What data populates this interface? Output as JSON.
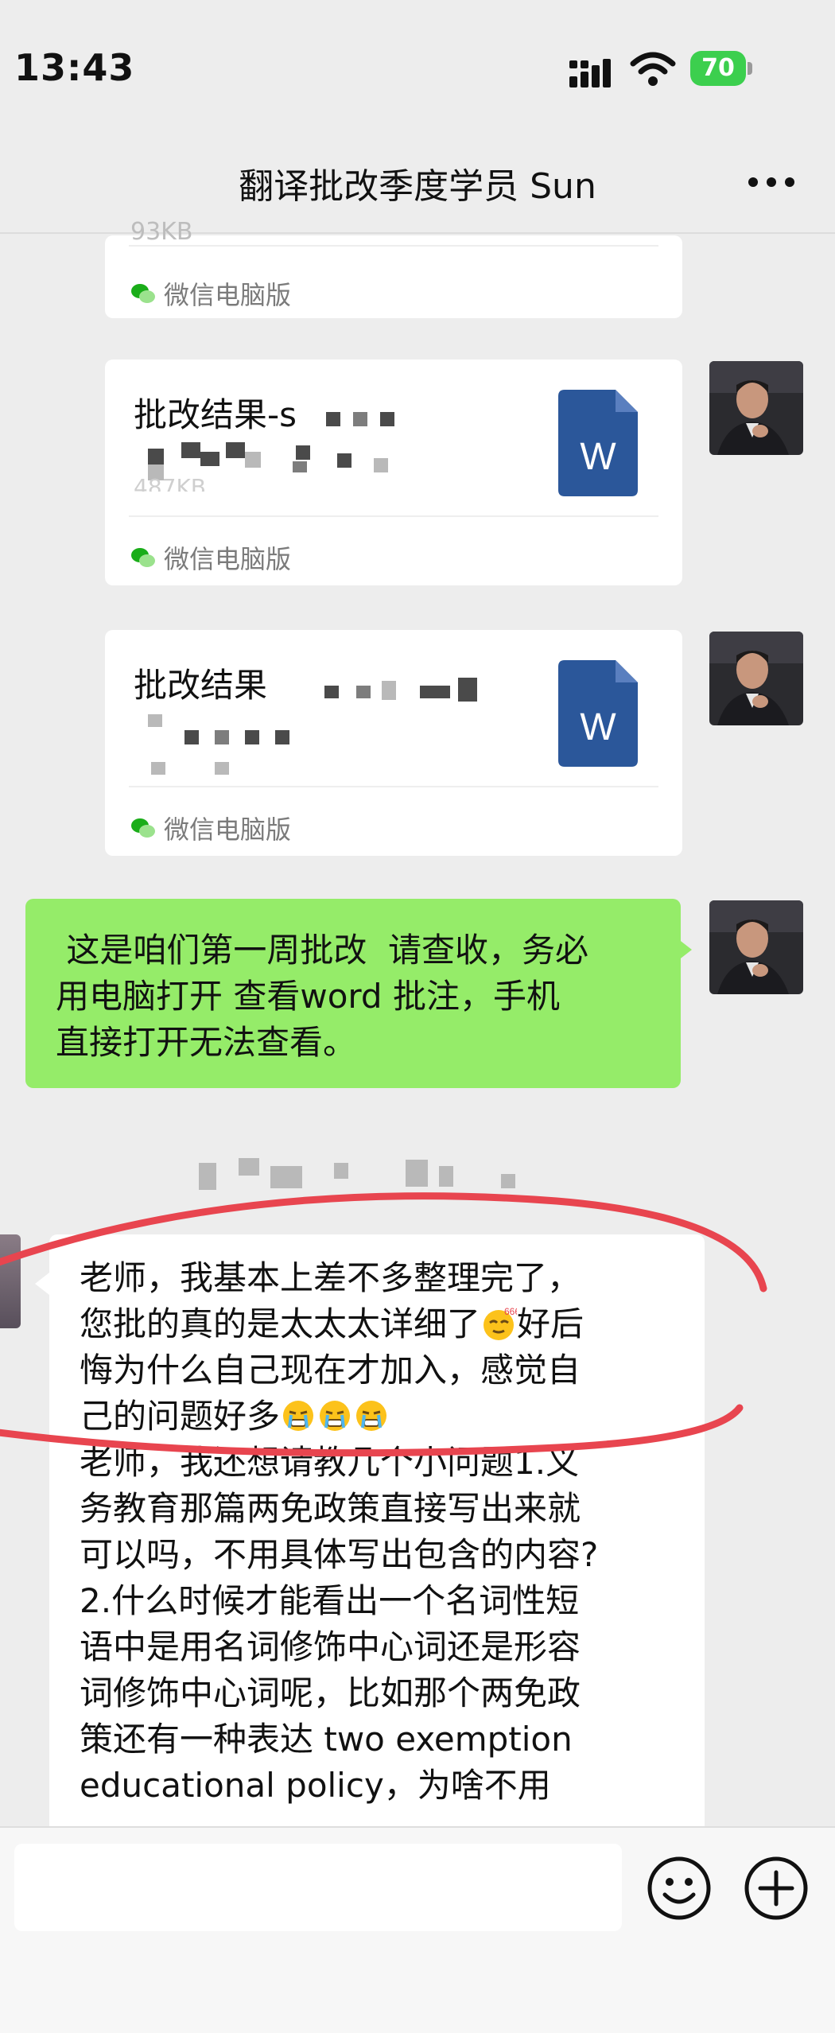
{
  "status_bar": {
    "time": "13:43",
    "battery_level": "70",
    "battery_color": "#3ccf4e"
  },
  "nav": {
    "title": "翻译批改季度学员 Sun",
    "more_icon": "more-dots-icon"
  },
  "messages": {
    "partial_file_card": {
      "size_fragment": "93KB",
      "source_label": "微信电脑版"
    },
    "file_card_1": {
      "title": "批改结果-s",
      "size_fragment": "487KB",
      "source_label": "微信电脑版",
      "file_type_letter": "W"
    },
    "file_card_2": {
      "title": "批改结果",
      "source_label": "微信电脑版",
      "file_type_letter": "W"
    },
    "text_sent": {
      "lines": [
        " 这是咱们第一周批改  请查收，务必",
        "用电脑打开 查看word 批注，手机",
        "直接打开无法查看。"
      ]
    },
    "text_received": {
      "line1": "老师，我基本上差不多整理完了，",
      "line2_a": "您批的真的是太太太详细了",
      "line2_b": "好后",
      "line3": "悔为什么自己现在才加入，感觉自",
      "line4": "己的问题好多",
      "line5": "老师，我还想请教几个小问题1.义",
      "line6": "务教育那篇两免政策直接写出来就",
      "line7": "可以吗，不用具体写出包含的内容?",
      "line8": "2.什么时候才能看出一个名词性短",
      "line9": "语中是用名词修饰中心词还是形容",
      "line10": "词修饰中心词呢，比如那个两免政",
      "line11": "策还有一种表达 two exemption",
      "line12": "educational policy，为啥不用"
    }
  },
  "colors": {
    "sent_bubble": "#95ec69",
    "word_icon": "#2b579a",
    "annotation_stroke": "#e8454f",
    "background": "#ededed"
  },
  "input_bar": {
    "emoji_icon": "emoji-smile-icon",
    "plus_icon": "plus-circle-icon"
  }
}
